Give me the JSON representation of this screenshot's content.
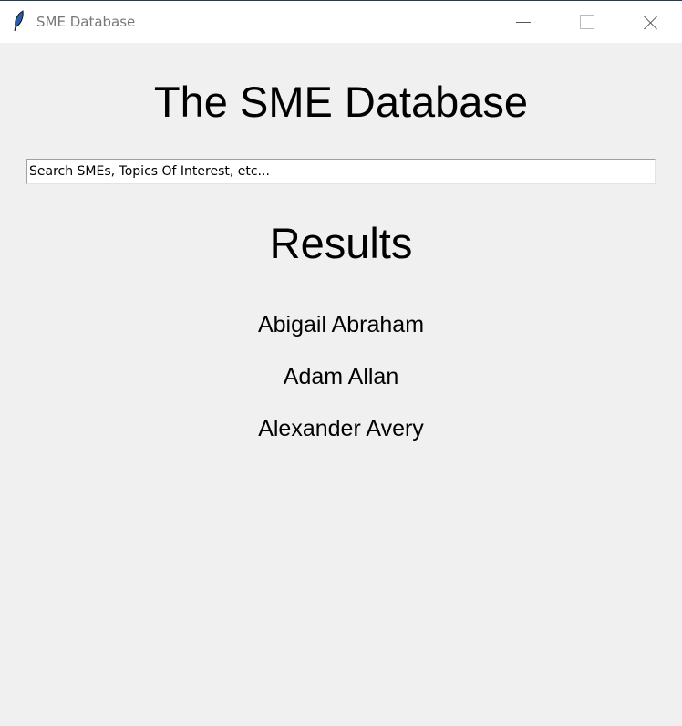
{
  "window": {
    "title": "SME Database",
    "icon": "feather-icon"
  },
  "header": {
    "title": "The SME Database"
  },
  "search": {
    "value": "Search SMEs, Topics Of Interest, etc..."
  },
  "results": {
    "heading": "Results",
    "items": [
      "Abigail Abraham",
      "Adam Allan",
      "Alexander Avery"
    ]
  }
}
